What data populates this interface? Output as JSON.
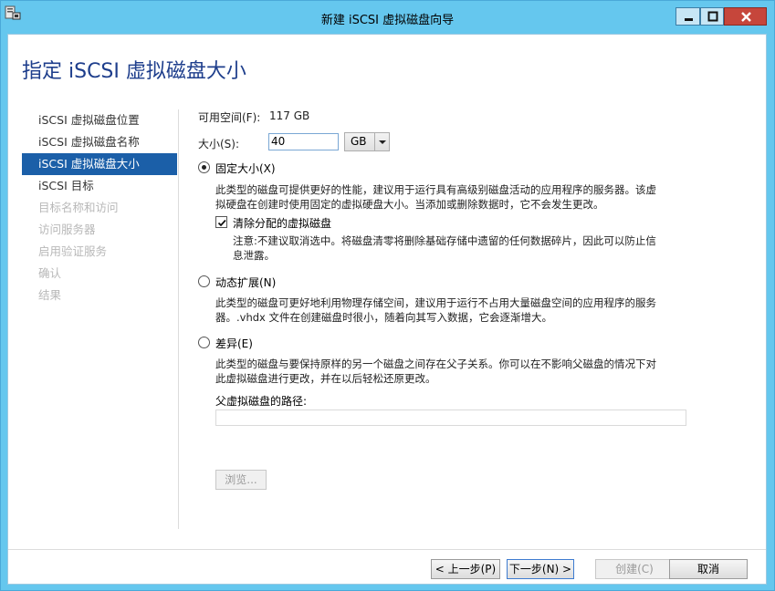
{
  "window": {
    "title": "新建 iSCSI 虚拟磁盘向导",
    "page_title": "指定 iSCSI 虚拟磁盘大小"
  },
  "nav": {
    "items": [
      {
        "label": "iSCSI 虚拟磁盘位置",
        "state": "normal"
      },
      {
        "label": "iSCSI 虚拟磁盘名称",
        "state": "normal"
      },
      {
        "label": "iSCSI 虚拟磁盘大小",
        "state": "active"
      },
      {
        "label": "iSCSI 目标",
        "state": "normal"
      },
      {
        "label": "目标名称和访问",
        "state": "disabled"
      },
      {
        "label": "访问服务器",
        "state": "disabled"
      },
      {
        "label": "启用验证服务",
        "state": "disabled"
      },
      {
        "label": "确认",
        "state": "disabled"
      },
      {
        "label": "结果",
        "state": "disabled"
      }
    ]
  },
  "size": {
    "free_label": "可用空间(F):",
    "free_value": "117 GB",
    "size_label": "大小(S):",
    "size_value": "40",
    "unit": "GB"
  },
  "options": {
    "fixed": {
      "label": "固定大小(X)",
      "selected": true,
      "desc_line1": "此类型的磁盘可提供更好的性能，建议用于运行具有高级别磁盘活动的应用程序的服务器。该虚",
      "desc_line2": "拟硬盘在创建时使用固定的虚拟硬盘大小。当添加或删除数据时，它不会发生更改。",
      "clear_checkbox_label": "清除分配的虚拟磁盘",
      "clear_checked": true,
      "clear_note_line1": "注意:不建议取消选中。将磁盘清零将删除基础存储中遗留的任何数据碎片，因此可以防止信",
      "clear_note_line2": "息泄露。"
    },
    "dynamic": {
      "label": "动态扩展(N)",
      "selected": false,
      "desc_line1": "此类型的磁盘可更好地利用物理存储空间，建议用于运行不占用大量磁盘空间的应用程序的服务",
      "desc_line2": "器。.vhdx 文件在创建磁盘时很小，随着向其写入数据，它会逐渐增大。"
    },
    "differencing": {
      "label": "差异(E)",
      "selected": false,
      "desc_line1": "此类型的磁盘与要保持原样的另一个磁盘之间存在父子关系。你可以在不影响父磁盘的情况下对",
      "desc_line2": "此虚拟磁盘进行更改，并在以后轻松还原更改。",
      "parent_path_label": "父虚拟磁盘的路径:",
      "parent_path_value": "",
      "browse_label": "浏览..."
    }
  },
  "footer": {
    "prev_label": "< 上一步(P)",
    "next_label": "下一步(N) >",
    "create_label": "创建(C)",
    "cancel_label": "取消"
  },
  "colors": {
    "title_bar": "#65c7ee",
    "close_button": "#c6463b",
    "nav_active": "#1b5fa8",
    "page_title": "#1e3e8c"
  }
}
